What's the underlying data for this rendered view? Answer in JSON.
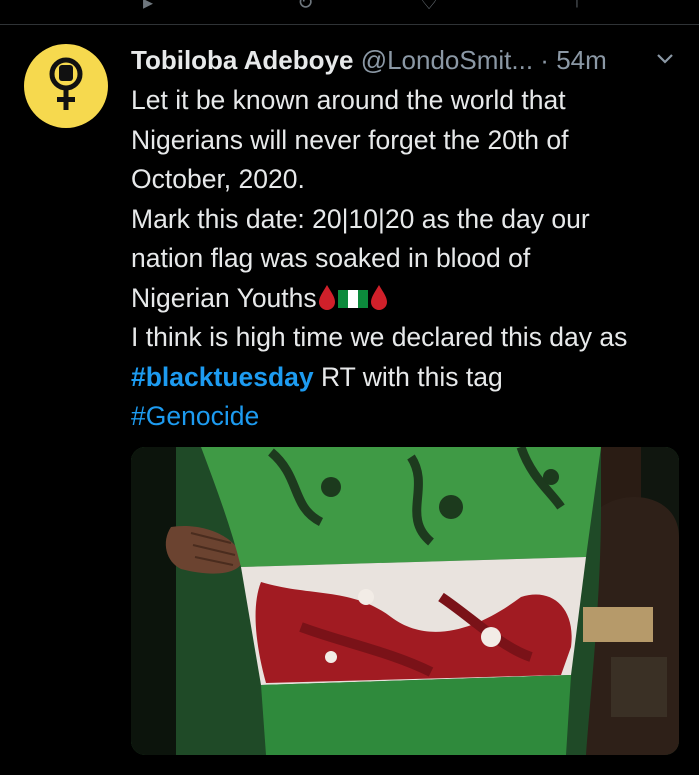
{
  "tweet": {
    "display_name": "Tobiloba Adeboye",
    "handle": "@LondoSmit...",
    "separator": "·",
    "time": "54m",
    "lines": [
      "Let it be known around the world that",
      "Nigerians will never forget the 20th of",
      "October, 2020.",
      "Mark this date: 20|10|20 as the day our",
      "nation flag was soaked in blood of"
    ],
    "line_youths": "Nigerian Youths",
    "line_declared": "I think is high time we declared this day as",
    "hashtag_blacktuesday": "#blacktuesday",
    "after_hashtag": " RT with this tag",
    "hashtag_genocide": "#Genocide"
  },
  "icons": {
    "avatar": "female-symbol-fist-icon",
    "menu": "chevron-down-icon",
    "emoji_left": "blood-drop-icon",
    "emoji_middle": "nigeria-flag-icon",
    "emoji_right": "blood-drop-icon"
  },
  "colors": {
    "background": "#000000",
    "avatar_bg": "#f6d94e",
    "link": "#1d9bf0",
    "muted": "#8b98a5"
  }
}
